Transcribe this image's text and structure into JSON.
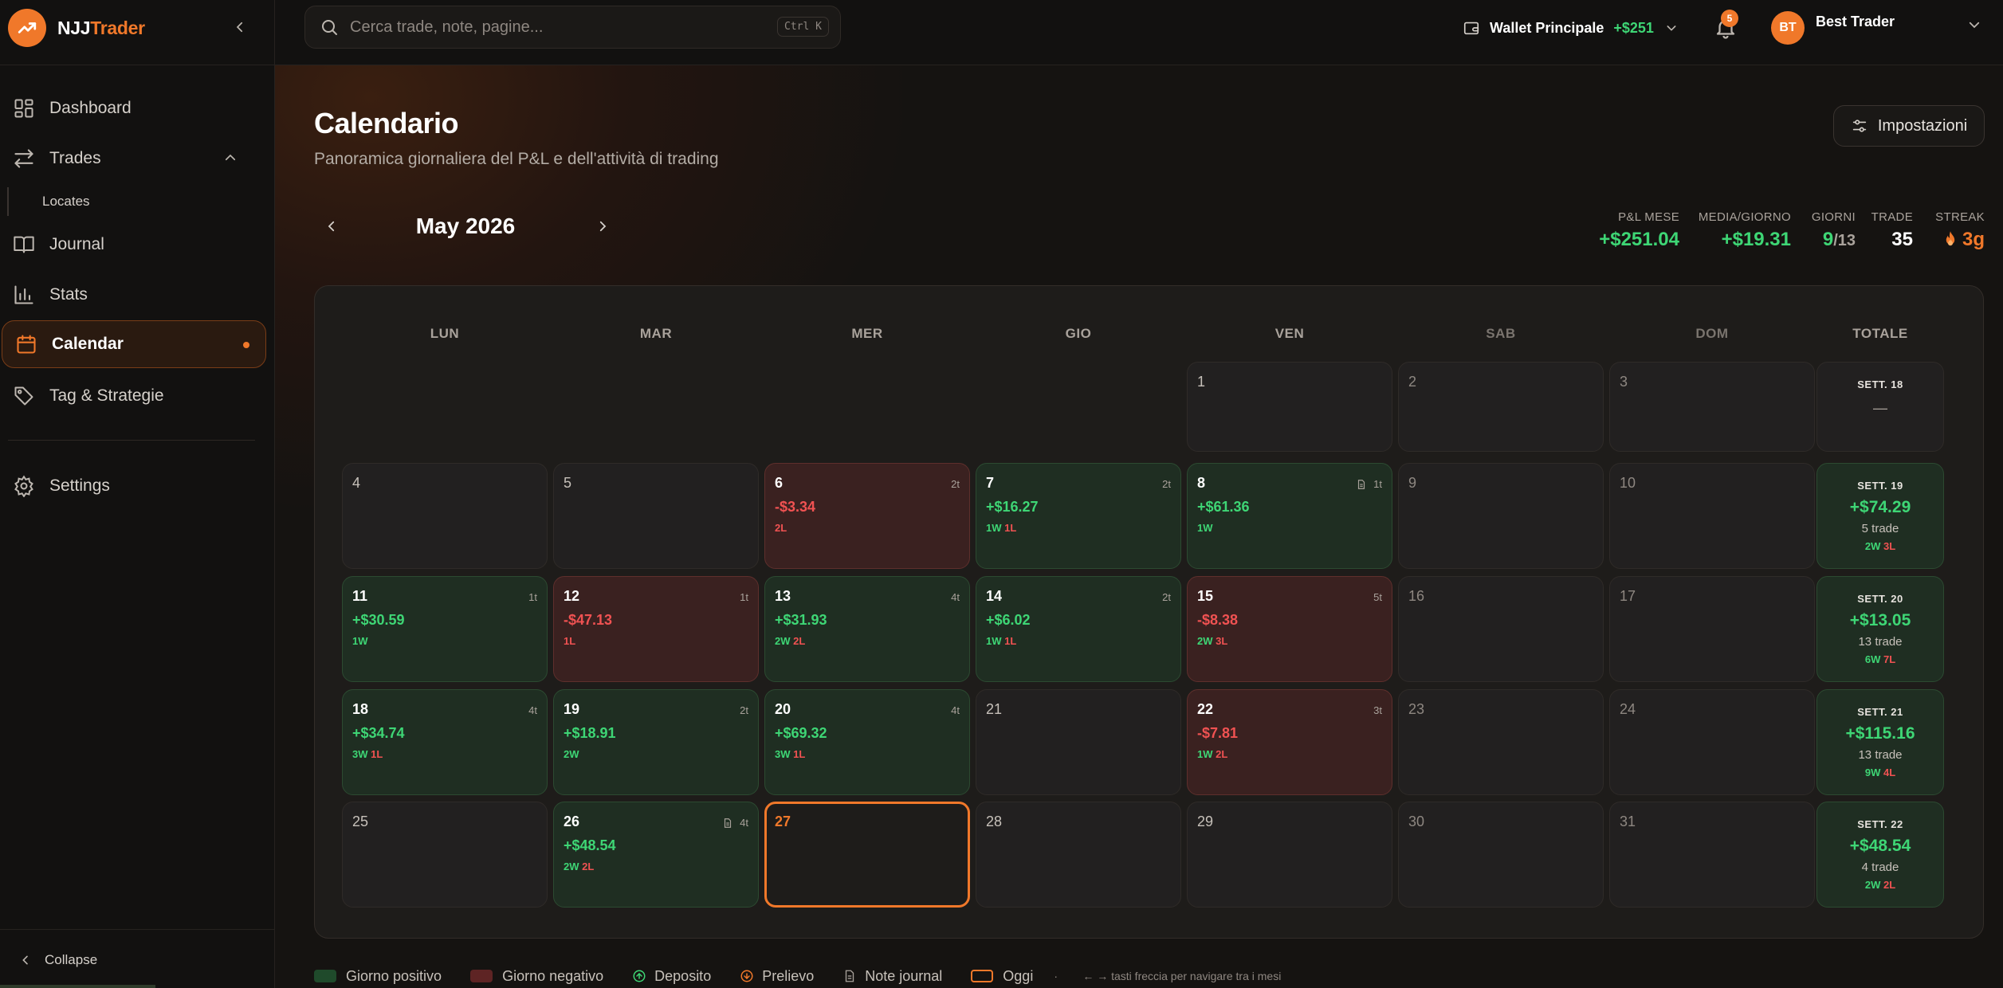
{
  "app": {
    "logo_prefix": "NJJ",
    "logo_suffix": "Trader"
  },
  "sidebar": {
    "items": [
      {
        "label": "Dashboard",
        "icon": "dashboard-icon"
      },
      {
        "label": "Trades",
        "icon": "arrows-swap-icon"
      },
      {
        "label": "Journal",
        "icon": "book-icon"
      },
      {
        "label": "Stats",
        "icon": "bar-chart-icon"
      },
      {
        "label": "Calendar",
        "icon": "calendar-icon"
      },
      {
        "label": "Tag & Strategie",
        "icon": "tag-icon"
      },
      {
        "label": "Settings",
        "icon": "gear-icon"
      }
    ],
    "sub_item": "Locates",
    "active": "Calendar",
    "collapse_label": "Collapse"
  },
  "topbar": {
    "search_placeholder": "Cerca trade, note, pagine...",
    "search_shortcut": "Ctrl K",
    "wallet_name": "Wallet Principale",
    "wallet_amount": "+$251",
    "notifications": "5",
    "user_initials": "BT",
    "user_name": "Best Trader"
  },
  "page": {
    "title": "Calendario",
    "subtitle": "Panoramica giornaliera del P&L e dell'attività di trading",
    "settings_label": "Impostazioni",
    "month_label": "May 2026"
  },
  "stats": {
    "pnl_label": "P&L MESE",
    "pnl_value": "+$251.04",
    "avg_label": "MEDIA/GIORNO",
    "avg_value": "+$19.31",
    "days_label": "GIORNI",
    "days_value": "9",
    "days_total": "/13",
    "trades_label": "TRADE",
    "trades_value": "35",
    "streak_label": "STREAK",
    "streak_value": "3g"
  },
  "calendar": {
    "headers": [
      "LUN",
      "MAR",
      "MER",
      "GIO",
      "VEN",
      "SAB",
      "DOM"
    ],
    "total_header": "TOTALE",
    "weeks": [
      {
        "days": [
          {
            "d": "",
            "t": "empty"
          },
          {
            "d": "",
            "t": "empty"
          },
          {
            "d": "",
            "t": "empty"
          },
          {
            "d": "",
            "t": "empty"
          },
          {
            "d": "1",
            "t": "plain"
          },
          {
            "d": "2",
            "t": "wk"
          },
          {
            "d": "3",
            "t": "wk"
          }
        ],
        "total": {
          "label": "SETT. 18",
          "value": "—",
          "trades": "",
          "w": "",
          "l": "",
          "pos": false
        }
      },
      {
        "days": [
          {
            "d": "4",
            "t": "plain"
          },
          {
            "d": "5",
            "t": "plain"
          },
          {
            "d": "6",
            "t": "neg",
            "n": "2t",
            "p": "-$3.34",
            "w": "",
            "l": "2L"
          },
          {
            "d": "7",
            "t": "pos",
            "n": "2t",
            "p": "+$16.27",
            "w": "1W",
            "l": "1L"
          },
          {
            "d": "8",
            "t": "pos",
            "n": "1t",
            "p": "+$61.36",
            "w": "1W",
            "l": "",
            "note": true
          },
          {
            "d": "9",
            "t": "wk"
          },
          {
            "d": "10",
            "t": "wk"
          }
        ],
        "total": {
          "label": "SETT. 19",
          "value": "+$74.29",
          "trades": "5 trade",
          "w": "2W",
          "l": "3L",
          "pos": true
        }
      },
      {
        "days": [
          {
            "d": "11",
            "t": "pos",
            "n": "1t",
            "p": "+$30.59",
            "w": "1W",
            "l": ""
          },
          {
            "d": "12",
            "t": "neg",
            "n": "1t",
            "p": "-$47.13",
            "w": "",
            "l": "1L"
          },
          {
            "d": "13",
            "t": "pos",
            "n": "4t",
            "p": "+$31.93",
            "w": "2W",
            "l": "2L"
          },
          {
            "d": "14",
            "t": "pos",
            "n": "2t",
            "p": "+$6.02",
            "w": "1W",
            "l": "1L"
          },
          {
            "d": "15",
            "t": "neg",
            "n": "5t",
            "p": "-$8.38",
            "w": "2W",
            "l": "3L"
          },
          {
            "d": "16",
            "t": "wk"
          },
          {
            "d": "17",
            "t": "wk"
          }
        ],
        "total": {
          "label": "SETT. 20",
          "value": "+$13.05",
          "trades": "13 trade",
          "w": "6W",
          "l": "7L",
          "pos": true
        }
      },
      {
        "days": [
          {
            "d": "18",
            "t": "pos",
            "n": "4t",
            "p": "+$34.74",
            "w": "3W",
            "l": "1L"
          },
          {
            "d": "19",
            "t": "pos",
            "n": "2t",
            "p": "+$18.91",
            "w": "2W",
            "l": ""
          },
          {
            "d": "20",
            "t": "pos",
            "n": "4t",
            "p": "+$69.32",
            "w": "3W",
            "l": "1L"
          },
          {
            "d": "21",
            "t": "plain"
          },
          {
            "d": "22",
            "t": "neg",
            "n": "3t",
            "p": "-$7.81",
            "w": "1W",
            "l": "2L"
          },
          {
            "d": "23",
            "t": "wk"
          },
          {
            "d": "24",
            "t": "wk"
          }
        ],
        "total": {
          "label": "SETT. 21",
          "value": "+$115.16",
          "trades": "13 trade",
          "w": "9W",
          "l": "4L",
          "pos": true
        }
      },
      {
        "days": [
          {
            "d": "25",
            "t": "plain"
          },
          {
            "d": "26",
            "t": "pos",
            "n": "4t",
            "p": "+$48.54",
            "w": "2W",
            "l": "2L",
            "note": true
          },
          {
            "d": "27",
            "t": "today"
          },
          {
            "d": "28",
            "t": "plain"
          },
          {
            "d": "29",
            "t": "plain"
          },
          {
            "d": "30",
            "t": "wk"
          },
          {
            "d": "31",
            "t": "wk"
          }
        ],
        "total": {
          "label": "SETT. 22",
          "value": "+$48.54",
          "trades": "4 trade",
          "w": "2W",
          "l": "2L",
          "pos": true
        }
      }
    ]
  },
  "legend": {
    "positive": "Giorno positivo",
    "negative": "Giorno negativo",
    "deposit": "Deposito",
    "withdraw": "Prelievo",
    "notes": "Note journal",
    "today": "Oggi",
    "separator": "·",
    "hint": "← → tasti freccia per navigare tra i mesi"
  },
  "colors": {
    "accent": "#f0782a",
    "positive": "#3ed675",
    "negative": "#f05252",
    "positive_cell": "#1f2e22",
    "negative_cell": "#3a2120"
  }
}
